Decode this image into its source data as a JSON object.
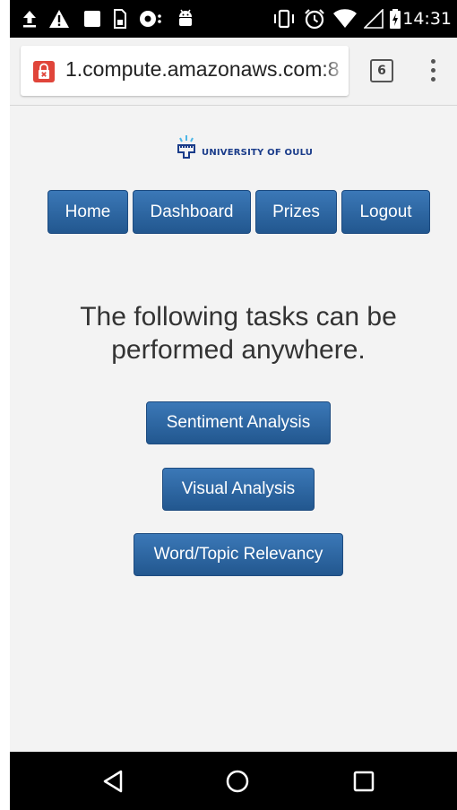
{
  "status_bar": {
    "time": "14:31",
    "icons": [
      "upload-icon",
      "warning-icon",
      "image-icon",
      "sim-card-icon",
      "messenger-icon",
      "android-icon",
      "vibrate-icon",
      "alarm-icon",
      "wifi-icon",
      "signal-icon",
      "battery-charging-icon"
    ]
  },
  "browser": {
    "url": "1.compute.amazonaws.com:8",
    "tab_count": "6",
    "lock_icon": "insecure-lock-icon",
    "menu_icon": "more-vert-icon"
  },
  "page": {
    "logo_text": "UNIVERSITY OF OULU",
    "nav": [
      {
        "label": "Home"
      },
      {
        "label": "Dashboard"
      },
      {
        "label": "Prizes"
      },
      {
        "label": "Logout"
      }
    ],
    "heading": "The following tasks can be performed anywhere.",
    "tasks": [
      {
        "label": "Sentiment Analysis"
      },
      {
        "label": "Visual Analysis"
      },
      {
        "label": "Word/Topic Relevancy"
      }
    ]
  },
  "nav_bar": {
    "icons": [
      "back-icon",
      "home-icon",
      "recents-icon"
    ]
  },
  "colors": {
    "button_top": "#3b78b7",
    "button_bottom": "#22578f",
    "button_border": "#1d4b80",
    "logo_blue": "#1a3c8a",
    "logo_accent": "#4db6e6",
    "lock_red": "#e0453a"
  }
}
